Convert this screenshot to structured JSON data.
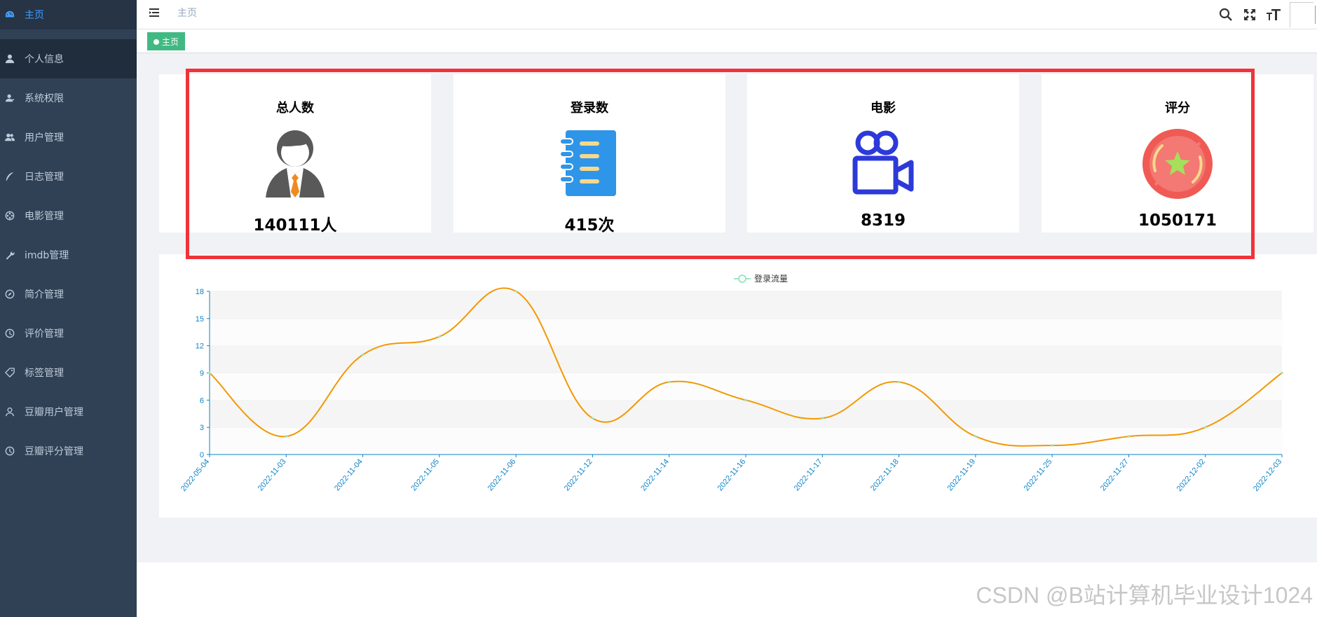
{
  "sidebar": {
    "items": [
      {
        "label": "主页",
        "icon": "dashboard-icon"
      },
      {
        "label": "个人信息",
        "icon": "user-icon"
      },
      {
        "label": "系统权限",
        "icon": "peoples-icon"
      },
      {
        "label": "用户管理",
        "icon": "users-icon"
      },
      {
        "label": "日志管理",
        "icon": "pen-icon"
      },
      {
        "label": "电影管理",
        "icon": "film-icon"
      },
      {
        "label": "imdb管理",
        "icon": "wrench-icon"
      },
      {
        "label": "简介管理",
        "icon": "compass-icon"
      },
      {
        "label": "评价管理",
        "icon": "clock-icon"
      },
      {
        "label": "标签管理",
        "icon": "tag-icon"
      },
      {
        "label": "豆瓣用户管理",
        "icon": "person-icon"
      },
      {
        "label": "豆瓣评分管理",
        "icon": "clock-icon"
      }
    ]
  },
  "navbar": {
    "breadcrumb": "主页"
  },
  "tags_view": {
    "active_tag": "主页"
  },
  "cards": [
    {
      "title": "总人数",
      "value": "140111人",
      "icon": "person-suit-icon"
    },
    {
      "title": "登录数",
      "value": "415次",
      "icon": "notebook-icon"
    },
    {
      "title": "电影",
      "value": "8319",
      "icon": "video-camera-icon"
    },
    {
      "title": "评分",
      "value": "1050171",
      "icon": "star-badge-icon"
    }
  ],
  "colors": {
    "sidebar_bg": "#304156",
    "active": "#409EFF",
    "tag": "#42b983",
    "line": "#f39800",
    "highlight": "#f0333a",
    "axis": "#0c83c7"
  },
  "chart_data": {
    "type": "line",
    "legend": "登录流量",
    "categories": [
      "2022-05-04",
      "2022-11-03",
      "2022-11-04",
      "2022-11-05",
      "2022-11-06",
      "2022-11-12",
      "2022-11-14",
      "2022-11-16",
      "2022-11-17",
      "2022-11-18",
      "2022-11-19",
      "2022-11-25",
      "2022-11-27",
      "2022-12-02",
      "2022-12-03"
    ],
    "series": [
      {
        "name": "登录流量",
        "values": [
          9,
          2,
          11,
          13,
          18,
          4,
          8,
          6,
          4,
          8,
          2,
          1,
          2,
          3,
          9
        ]
      }
    ],
    "ylim": [
      0,
      18
    ],
    "yticks": [
      0,
      3,
      6,
      9,
      12,
      15,
      18
    ],
    "smooth": true,
    "grid": "horizontal bands"
  },
  "watermark": "CSDN @B站计算机毕业设计1024"
}
